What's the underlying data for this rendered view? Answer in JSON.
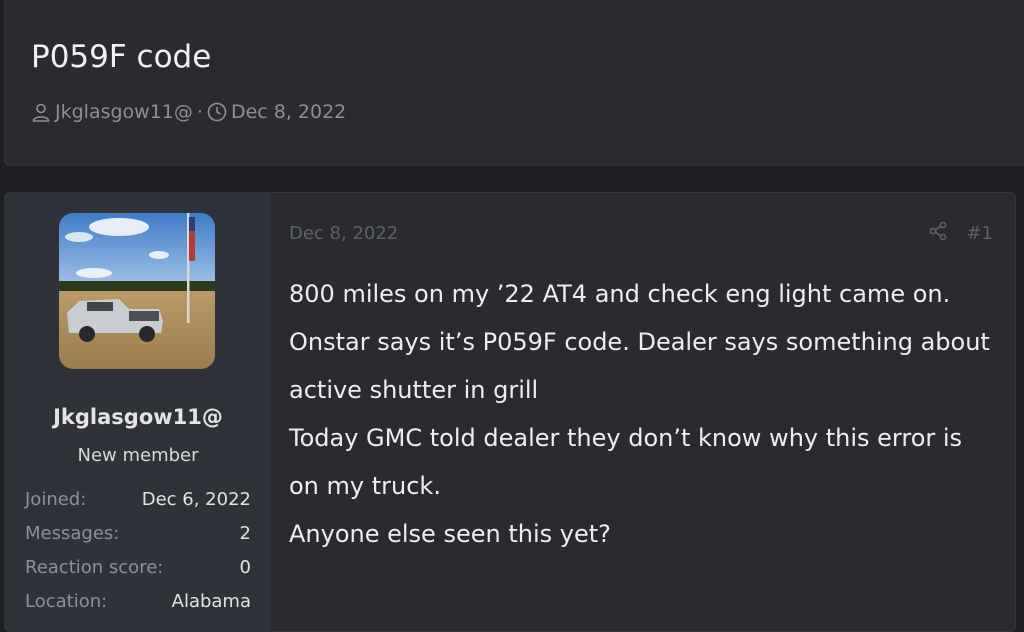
{
  "thread": {
    "title": "P059F code",
    "author": "Jkglasgow11@",
    "separator": "·",
    "date": "Dec 8, 2022"
  },
  "post": {
    "date": "Dec 8, 2022",
    "number": "#1",
    "lines": [
      "800 miles on my ’22 AT4 and check eng light came on.",
      "Onstar says it’s P059F code. Dealer says something about",
      "active shutter in grill",
      "Today GMC told dealer they don’t know why this error is",
      "on my truck.",
      "Anyone else seen this yet?"
    ]
  },
  "user": {
    "name": "Jkglasgow11@",
    "title": "New member",
    "stats": [
      {
        "label": "Joined:",
        "value": "Dec 6, 2022"
      },
      {
        "label": "Messages:",
        "value": "2"
      },
      {
        "label": "Reaction score:",
        "value": "0"
      },
      {
        "label": "Location:",
        "value": "Alabama"
      }
    ]
  },
  "colors": {
    "background": "#1e1f23",
    "panel": "#2a2b31",
    "user_panel": "#30323a",
    "muted_text": "#8c8f99"
  },
  "icons": {
    "author": "user-icon",
    "date": "clock-icon",
    "share": "share-icon"
  }
}
